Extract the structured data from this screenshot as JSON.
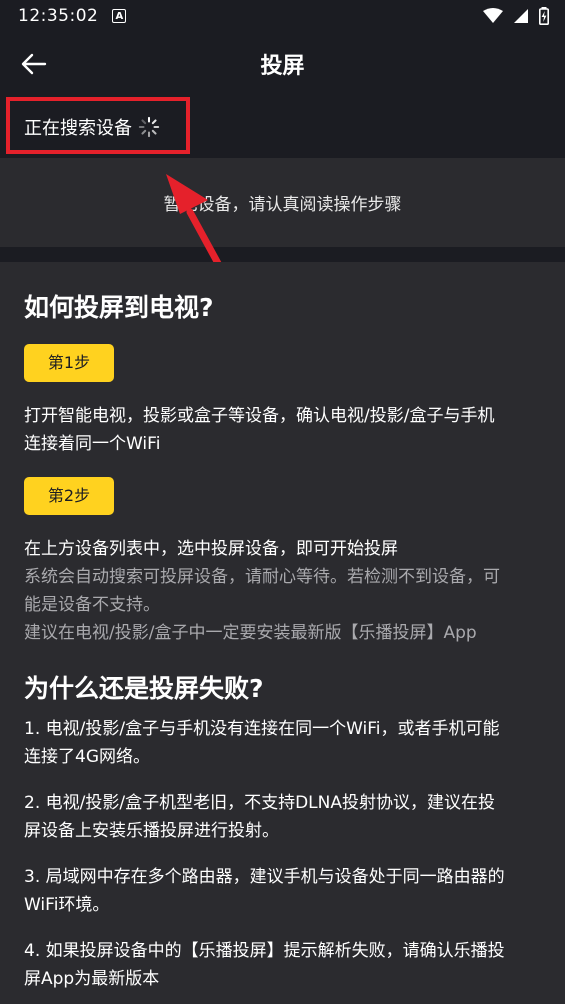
{
  "status_bar": {
    "time": "12:35:02",
    "a_label": "A",
    "icons": [
      "wifi-icon",
      "signal-icon",
      "battery-icon"
    ]
  },
  "app_bar": {
    "title": "投屏",
    "back_icon": "back-arrow-icon"
  },
  "search": {
    "status_text": "正在搜索设备"
  },
  "empty_state": {
    "text": "暂无设备，请认真阅读操作步骤"
  },
  "guide": {
    "title1": "如何投屏到电视?",
    "step1_label": "第1步",
    "step1_line1": "打开智能电视，投影或盒子等设备，确认电视/投影/盒子与手机",
    "step1_line2": "连接着同一个WiFi",
    "step2_label": "第2步",
    "step2_line1": "在上方设备列表中，选中投屏设备，即可开始投屏",
    "note_line1": "系统会自动搜索可投屏设备，请耐心等待。若检测不到设备，可",
    "note_line2": "能是设备不支持。",
    "note_line3": "建议在电视/投影/盒子中一定要安装最新版【乐播投屏】App",
    "title2": "为什么还是投屏失败?",
    "reason1_line1": "1. 电视/投影/盒子与手机没有连接在同一个WiFi，或者手机可能",
    "reason1_line2": "连接了4G网络。",
    "reason2_line1": " 2. 电视/投影/盒子机型老旧，不支持DLNA投射协议，建议在投",
    "reason2_line2": "屏设备上安装乐播投屏进行投射。",
    "reason3_line1": " 3. 局域网中存在多个路由器，建议手机与设备处于同一路由器的",
    "reason3_line2": "WiFi环境。",
    "reason4_line1": " 4. 如果投屏设备中的【乐播投屏】提示解析失败，请确认乐播投",
    "reason4_line2": "屏App为最新版本"
  },
  "colors": {
    "background": "#1b1c22",
    "panel": "#2b2b2f",
    "accent_yellow": "#ffd21f",
    "highlight_red": "#e5212b",
    "muted_text": "#a9a9ad"
  }
}
